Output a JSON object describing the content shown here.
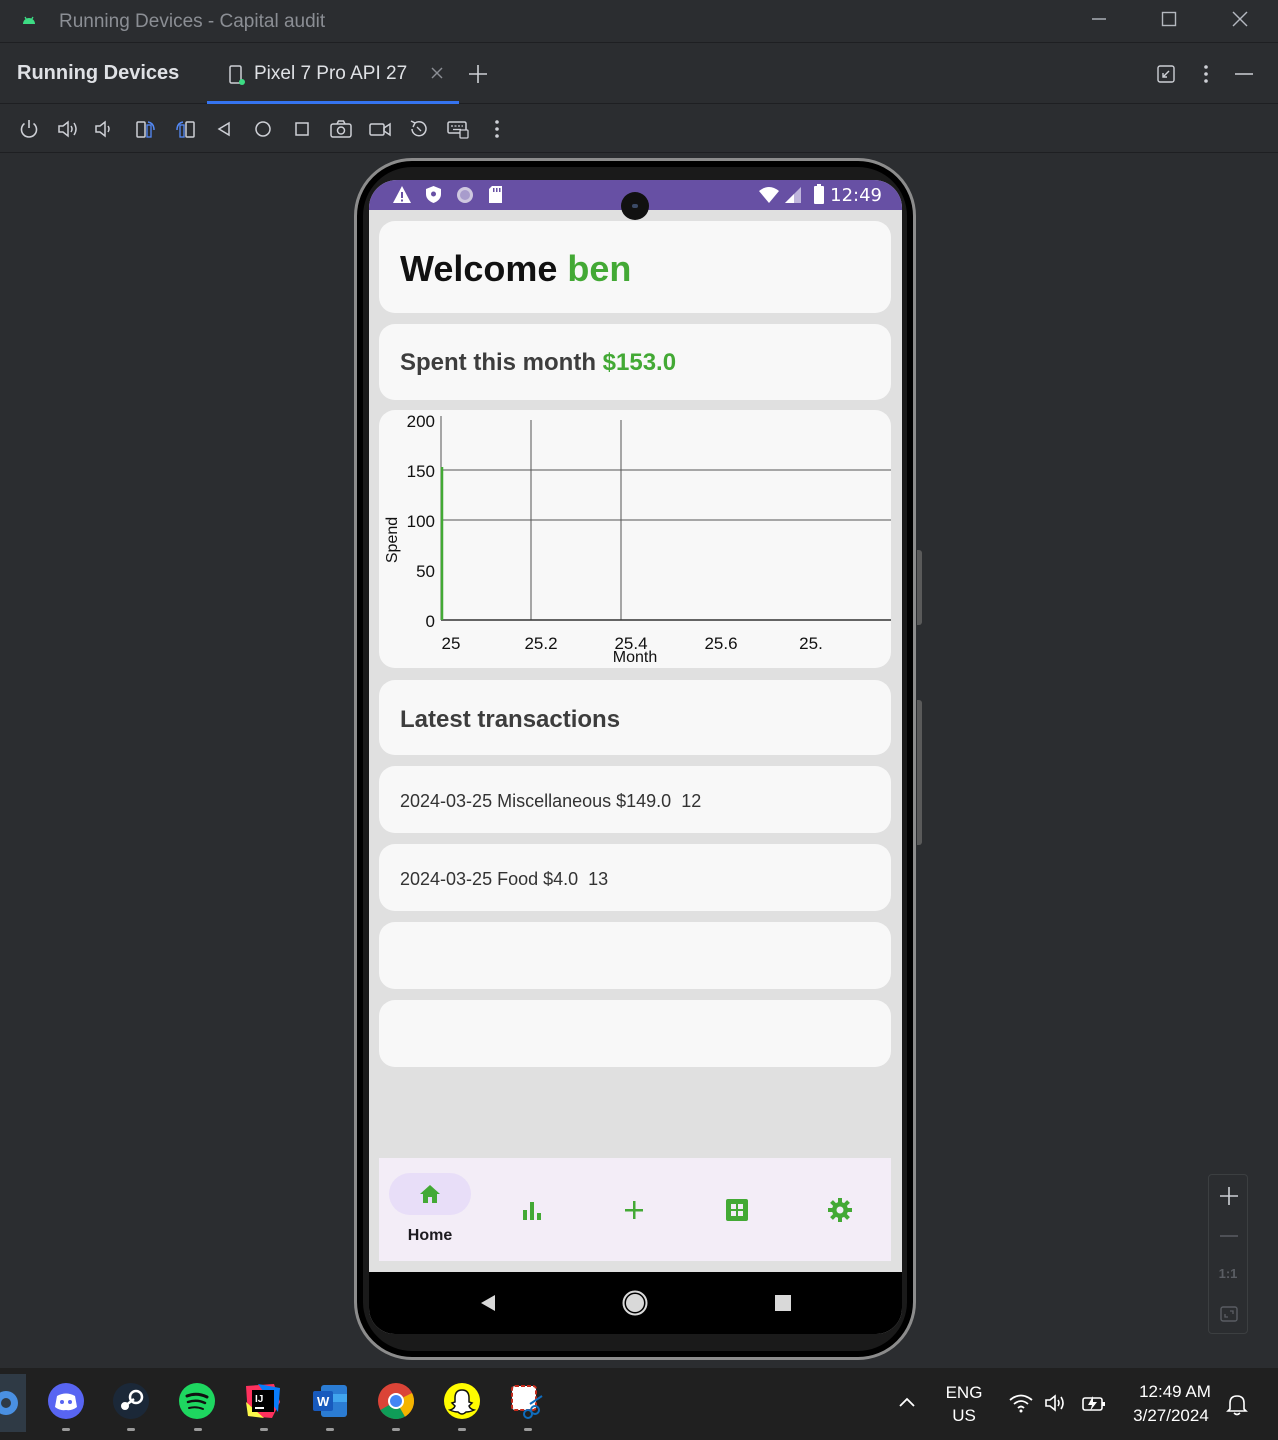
{
  "window": {
    "title": "Running Devices - Capital audit"
  },
  "panel": {
    "title": "Running Devices",
    "tab_label": "Pixel 7 Pro API 27"
  },
  "toolbar": {
    "icons": [
      "power-icon",
      "volume-up-icon",
      "volume-down-icon",
      "rotate-left-icon",
      "rotate-right-icon",
      "back-icon",
      "home-icon",
      "overview-icon",
      "screenshot-icon",
      "screen-record-icon",
      "reset-icon",
      "keyboard-icon",
      "more-icon"
    ]
  },
  "device": {
    "status_time": "12:49",
    "welcome_prefix": "Welcome",
    "user_name": "ben",
    "spent_label": "Spent this month",
    "spent_value": "$153.0",
    "transactions_title": "Latest transactions",
    "transactions": [
      "2024-03-25 Miscellaneous $149.0  12",
      "2024-03-25 Food $4.0  13",
      "",
      ""
    ],
    "nav": {
      "home_label": "Home",
      "items": [
        "home-icon",
        "stats-icon",
        "add-icon",
        "grid-icon",
        "settings-icon"
      ]
    }
  },
  "chart_data": {
    "type": "line",
    "xlabel": "Month",
    "ylabel": "Spend",
    "x_ticks": [
      "25",
      "25.2",
      "25.4",
      "25.6",
      "25."
    ],
    "y_ticks": [
      "200",
      "150",
      "100",
      "50",
      "0"
    ],
    "xlim": [
      25,
      25.8
    ],
    "ylim": [
      0,
      200
    ],
    "grid": true,
    "series": [
      {
        "color": "#43a935",
        "x": [
          25,
          25
        ],
        "y": [
          0,
          153
        ]
      }
    ]
  },
  "zoom": {
    "one_to_one": "1:1"
  },
  "taskbar": {
    "lang_top": "ENG",
    "lang_bottom": "US",
    "time": "12:49 AM",
    "date": "3/27/2024"
  },
  "colors": {
    "accent_green": "#43a935",
    "status_purple": "#6750a4",
    "nav_bg": "#f3edf7",
    "ide_bg": "#2b2d30"
  }
}
